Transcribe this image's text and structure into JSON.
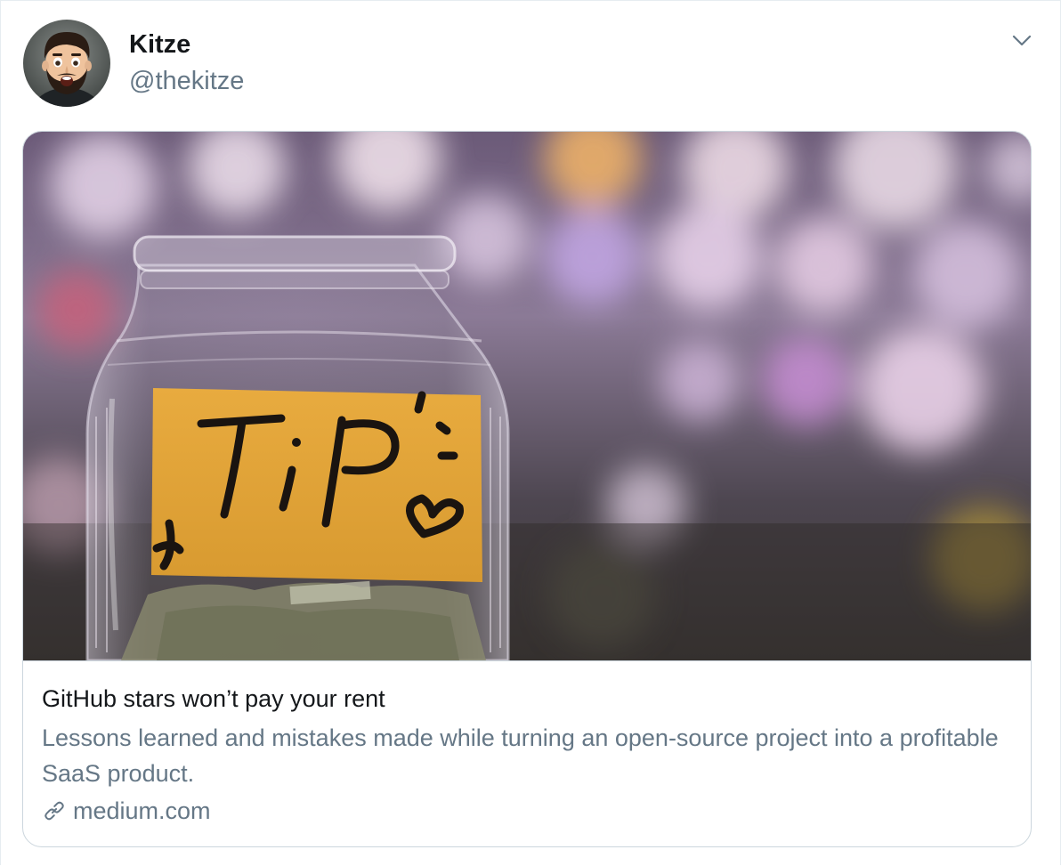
{
  "tweet": {
    "author": {
      "name": "Kitze",
      "handle": "@thekitze",
      "avatar_icon": "memoji-avatar"
    },
    "menu_icon": "chevron-down-icon"
  },
  "card": {
    "image_icon": "tip-jar-photo",
    "image_label_text": "TIP",
    "title": "GitHub stars won’t pay your rent",
    "description": "Lessons learned and mistakes made while turning an open-source project into a profitable SaaS product.",
    "domain": "medium.com",
    "domain_icon": "link-icon"
  },
  "colors": {
    "primary_text": "#14171a",
    "secondary_text": "#657786",
    "border": "#ccd6dd"
  }
}
